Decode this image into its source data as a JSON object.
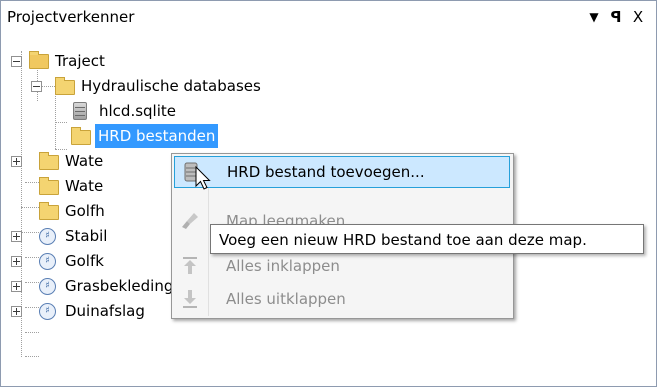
{
  "panel": {
    "title": "Projectverkenner",
    "dropdown_icon": "▼",
    "pin_icon": "⨅",
    "close_icon": "X"
  },
  "tree": {
    "root": "Traject",
    "hydraulic": "Hydraulische databases",
    "db_file": "hlcd.sqlite",
    "hrd_folder": "HRD bestanden",
    "item_wate1": "Wate",
    "item_wate2": "Wate",
    "item_golfh": "Golfh",
    "item_stabil": "Stabil",
    "item_golfk": "Golfk",
    "item_gras": "Grasbekleding erosie buitentalud",
    "item_duin": "Duinafslag"
  },
  "context_menu": {
    "add_hrd": "HRD bestand toevoegen...",
    "clear_map": "Map leegmaken",
    "collapse_all": "Alles inklappen",
    "expand_all": "Alles uitklappen"
  },
  "tooltip": "Voeg een nieuw HRD bestand toe aan deze map.",
  "colors": {
    "selection": "#3399ff",
    "menu_highlight": "#cce8ff",
    "folder": "#f4d471"
  }
}
